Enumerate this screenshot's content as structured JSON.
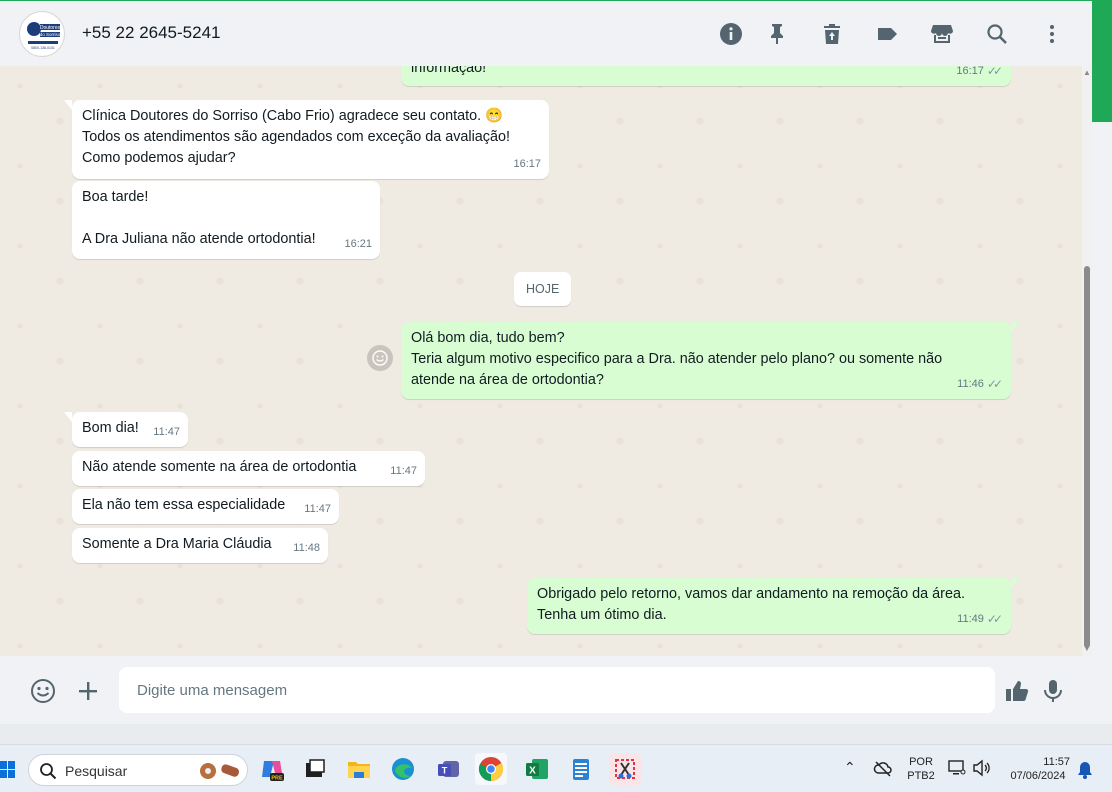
{
  "header": {
    "contact_name": "+55 22 2645-5241",
    "avatar_text_1": "Doutores",
    "avatar_text_2": "do Sorriso",
    "avatar_text_3": "0800-136-0101",
    "icons": [
      "info-icon",
      "pin-icon",
      "delete-icon",
      "label-icon",
      "store-icon",
      "search-icon",
      "menu-icon"
    ]
  },
  "chat": {
    "partial_message": {
      "text": "informação!",
      "time": "16:17"
    },
    "messages_in_1": [
      {
        "text": "Clínica Doutores do Sorriso (Cabo Frio) agradece seu contato. 😁\nTodos os atendimentos são agendados com exceção da avaliação!\nComo podemos ajudar?",
        "time": "16:17"
      },
      {
        "text": "Boa tarde!\n\nA Dra Juliana não atende ortodontia!",
        "time": "16:21"
      }
    ],
    "date_chip": "HOJE",
    "message_out_1": {
      "text": "Olá bom dia, tudo bem?\nTeria algum motivo especifico para a Dra. não atender pelo plano? ou somente não\natende na área de ortodontia?",
      "time": "11:46"
    },
    "messages_in_2": [
      {
        "text": "Bom dia!",
        "time": "11:47"
      },
      {
        "text": "Não atende somente na área de ortodontia",
        "time": "11:47"
      },
      {
        "text": "Ela não tem essa especialidade",
        "time": "11:47"
      },
      {
        "text": "Somente a Dra Maria Cláudia",
        "time": "11:48"
      }
    ],
    "message_out_2": {
      "text": "Obrigado pelo retorno, vamos dar andamento na remoção da área.\nTenha um ótimo dia.",
      "time": "11:49"
    },
    "read_ticks": "✓✓"
  },
  "composer": {
    "placeholder": "Digite uma mensagem"
  },
  "taskbar": {
    "search_placeholder": "Pesquisar",
    "lang_1": "POR",
    "lang_2": "PTB2",
    "clock_time": "11:57",
    "clock_date": "07/06/2024",
    "excel_letter": "X"
  },
  "colors": {
    "outgoing_bubble": "#d9fdd3",
    "incoming_bubble": "#ffffff",
    "chat_background": "#efeae2",
    "accent_green": "#1fa855"
  }
}
